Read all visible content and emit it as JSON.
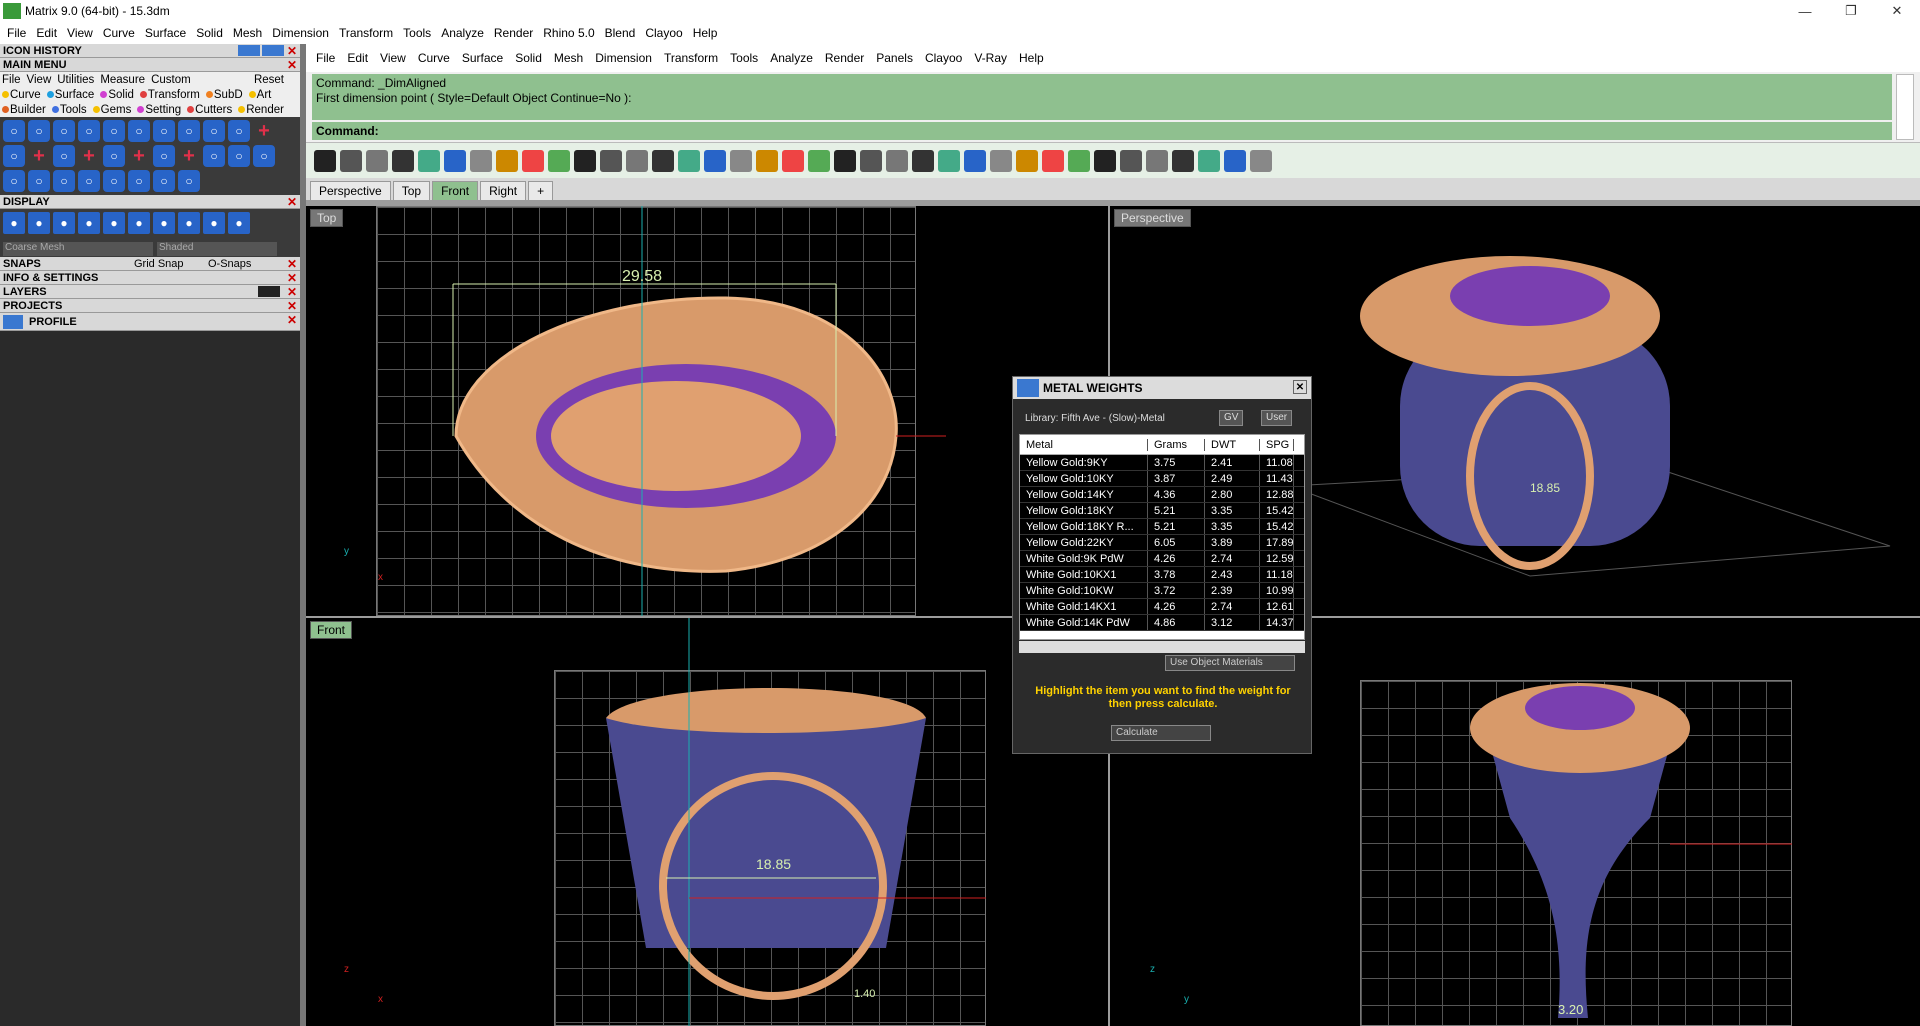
{
  "window": {
    "title": "Matrix 9.0 (64-bit) - 15.3dm"
  },
  "menu1": [
    "File",
    "Edit",
    "View",
    "Curve",
    "Surface",
    "Solid",
    "Mesh",
    "Dimension",
    "Transform",
    "Tools",
    "Analyze",
    "Render",
    "Rhino 5.0",
    "Blend",
    "Clayoo",
    "Help"
  ],
  "menu2": [
    "File",
    "Edit",
    "View",
    "Curve",
    "Surface",
    "Solid",
    "Mesh",
    "Dimension",
    "Transform",
    "Tools",
    "Analyze",
    "Render",
    "Panels",
    "Clayoo",
    "V-Ray",
    "Help"
  ],
  "left": {
    "icon_history": "ICON HISTORY",
    "main_menu": "MAIN MENU",
    "main_menu_items": [
      "File",
      "View",
      "Utilities",
      "Measure",
      "Custom"
    ],
    "reset": "Reset",
    "row1": [
      {
        "label": "Curve",
        "color": "#f5c000"
      },
      {
        "label": "Surface",
        "color": "#1ea0e0"
      },
      {
        "label": "Solid",
        "color": "#d040d0"
      },
      {
        "label": "Transform",
        "color": "#e04040"
      },
      {
        "label": "SubD",
        "color": "#f08020"
      },
      {
        "label": "Art",
        "color": "#f5c000"
      }
    ],
    "row2": [
      {
        "label": "Builder",
        "color": "#e06020"
      },
      {
        "label": "Tools",
        "color": "#4070e0"
      },
      {
        "label": "Gems",
        "color": "#f5c000"
      },
      {
        "label": "Setting",
        "color": "#d040d0"
      },
      {
        "label": "Cutters",
        "color": "#e04040"
      },
      {
        "label": "Render",
        "color": "#f5c000"
      }
    ],
    "display": "DISPLAY",
    "mesh_select": "Coarse Mesh",
    "shade_select": "Shaded",
    "snaps": "SNAPS",
    "grid_snap": "Grid Snap",
    "osnaps": "O-Snaps",
    "info": "INFO & SETTINGS",
    "layers": "LAYERS",
    "projects": "PROJECTS",
    "profile": "PROFILE"
  },
  "command": {
    "line1": "Command: _DimAligned",
    "line2": "First dimension point ( Style=Default  Object  Continue=No ):",
    "prompt": "Command:"
  },
  "viewport_tabs": [
    "Perspective",
    "Top",
    "Front",
    "Right"
  ],
  "active_tab": "Front",
  "viewports": {
    "top": {
      "label": "Top",
      "dimension": "29.58"
    },
    "perspective": {
      "label": "Perspective",
      "dimension": "18.85"
    },
    "front": {
      "label": "Front",
      "dimension": "18.85",
      "small_dim": "1.40"
    },
    "right": {
      "label": "",
      "dimension": "3.20"
    }
  },
  "metal_weights": {
    "title": "METAL WEIGHTS",
    "library": "Library: Fifth Ave - (Slow)-Metal",
    "gv": "GV",
    "user": "User",
    "columns": [
      "Metal",
      "Grams",
      "DWT",
      "SPG"
    ],
    "rows": [
      [
        "Yellow Gold:9KY",
        "3.75",
        "2.41",
        "11.08"
      ],
      [
        "Yellow Gold:10KY",
        "3.87",
        "2.49",
        "11.43"
      ],
      [
        "Yellow Gold:14KY",
        "4.36",
        "2.80",
        "12.88"
      ],
      [
        "Yellow Gold:18KY",
        "5.21",
        "3.35",
        "15.42"
      ],
      [
        "Yellow Gold:18KY R...",
        "5.21",
        "3.35",
        "15.42"
      ],
      [
        "Yellow Gold:22KY",
        "6.05",
        "3.89",
        "17.89"
      ],
      [
        "White Gold:9K PdW",
        "4.26",
        "2.74",
        "12.59"
      ],
      [
        "White Gold:10KX1",
        "3.78",
        "2.43",
        "11.18"
      ],
      [
        "White Gold:10KW",
        "3.72",
        "2.39",
        "10.99"
      ],
      [
        "White Gold:14KX1",
        "4.26",
        "2.74",
        "12.61"
      ],
      [
        "White Gold:14K PdW",
        "4.86",
        "3.12",
        "14.37"
      ]
    ],
    "materials_select": "Use Object Materials",
    "message": "Highlight the item you want to find the weight for then press calculate.",
    "calculate": "Calculate"
  },
  "axes": {
    "x": "x",
    "y": "y",
    "z": "z"
  }
}
